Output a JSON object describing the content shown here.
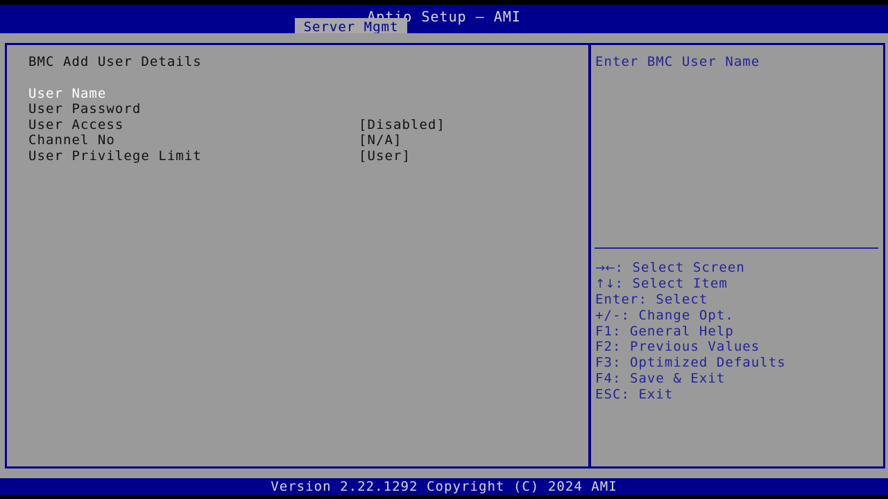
{
  "header": {
    "title": "Aptio Setup – AMI",
    "tab_label": "Server Mgmt"
  },
  "main": {
    "section_title": "BMC Add User Details",
    "items": [
      {
        "label": "User Name",
        "value": "",
        "selected": true
      },
      {
        "label": "User Password",
        "value": "",
        "selected": false
      },
      {
        "label": "User Access",
        "value": "[Disabled]",
        "selected": false
      },
      {
        "label": "Channel No",
        "value": "[N/A]",
        "selected": false
      },
      {
        "label": "User Privilege Limit",
        "value": "[User]",
        "selected": false
      }
    ]
  },
  "help": {
    "text": "Enter BMC User Name"
  },
  "legend": [
    {
      "keys": "→←",
      "text": ": Select Screen"
    },
    {
      "keys": "↑↓",
      "text": ": Select Item"
    },
    {
      "keys": "",
      "text": "Enter: Select"
    },
    {
      "keys": "",
      "text": "+/-: Change Opt."
    },
    {
      "keys": "",
      "text": "F1: General Help"
    },
    {
      "keys": "",
      "text": "F2: Previous Values"
    },
    {
      "keys": "",
      "text": "F3: Optimized Defaults"
    },
    {
      "keys": "",
      "text": "F4: Save & Exit"
    },
    {
      "keys": "",
      "text": "ESC: Exit"
    }
  ],
  "footer": {
    "version_text": "Version 2.22.1292 Copyright (C) 2024 AMI"
  },
  "colors": {
    "header_blue": "#00008f",
    "panel_gray": "#9a9a9a",
    "help_blue": "#23239c",
    "selected_white": "#ffffff",
    "text_dark": "#111111"
  }
}
